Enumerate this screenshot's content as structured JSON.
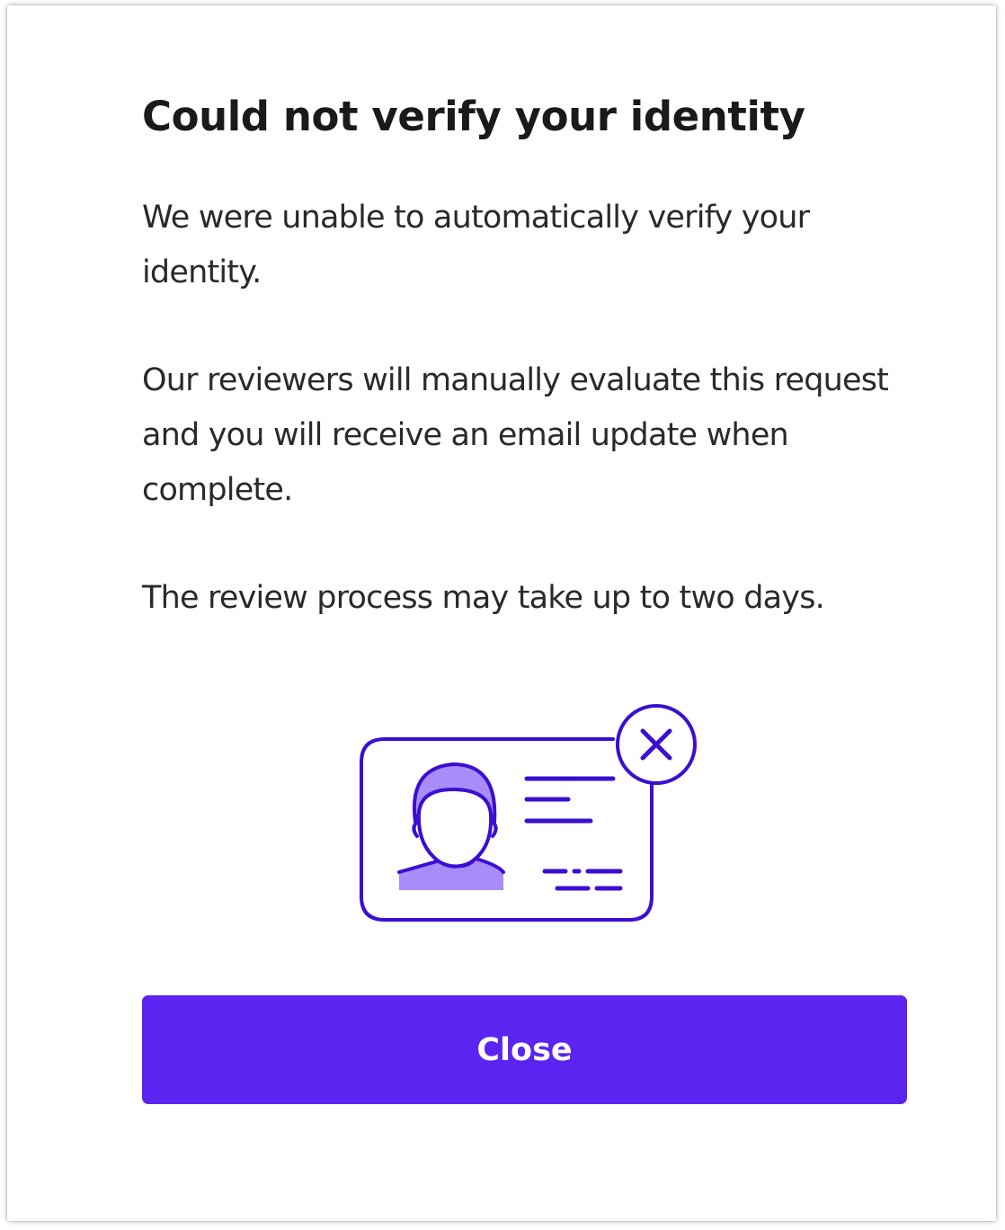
{
  "dialog": {
    "title": "Could not verify your identity",
    "paragraphs": [
      "We were unable to automatically verify your identity.",
      "Our reviewers will manually evaluate this request and you will receive an email update when complete.",
      "The review process may take up to two days."
    ],
    "illustration_icon": "id-card-failed-icon",
    "close_label": "Close"
  },
  "colors": {
    "accent": "#5b24f0",
    "illustration_stroke": "#3a0fd1",
    "illustration_fill": "#a98cf7"
  }
}
